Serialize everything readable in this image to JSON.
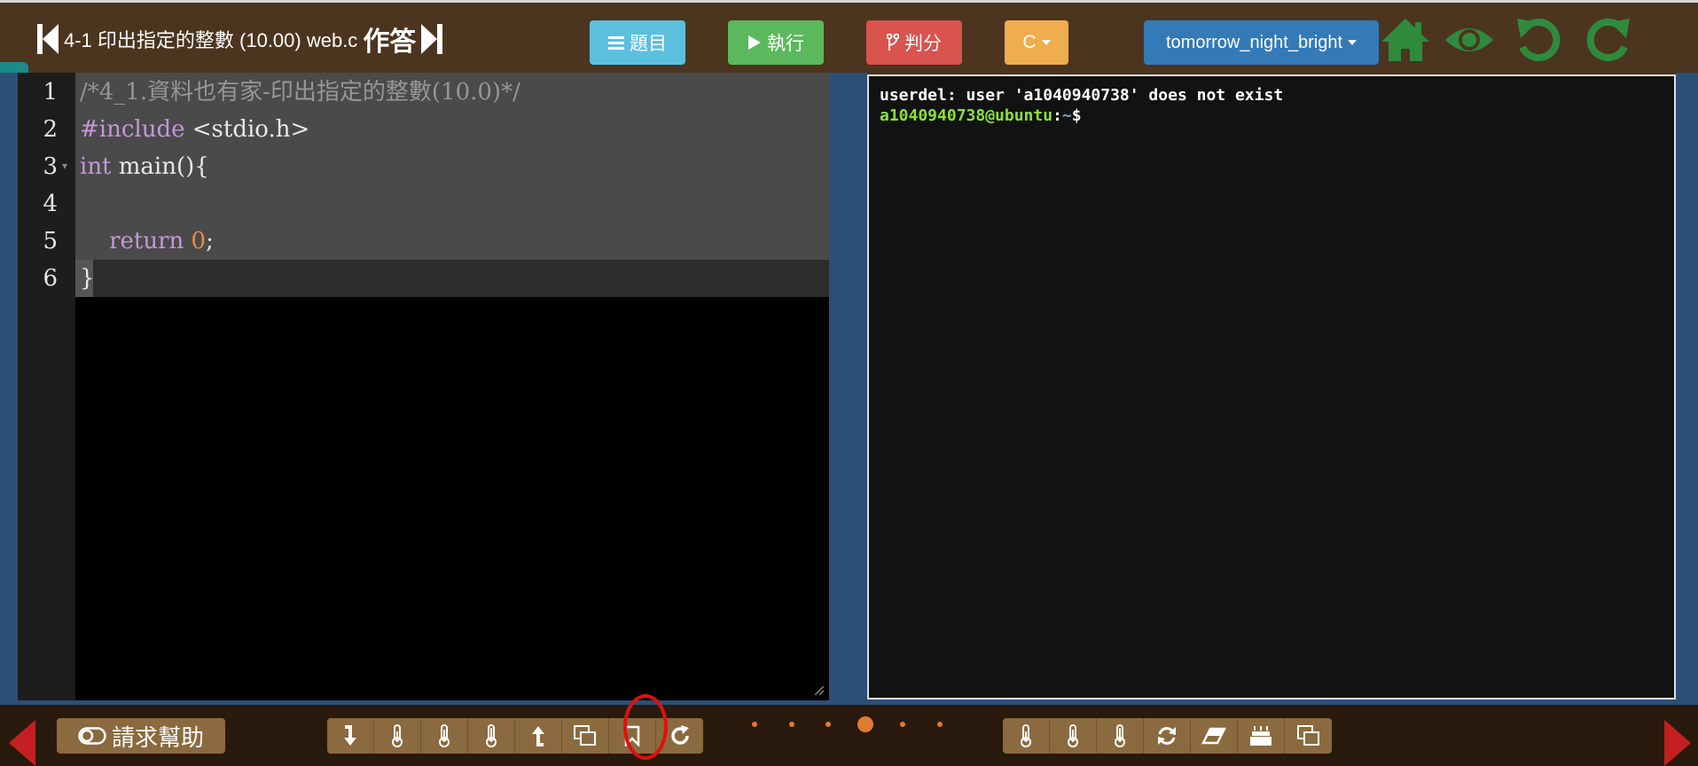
{
  "header": {
    "title": "4-1 印出指定的整數 (10.00) web.c",
    "answer_label": "作答"
  },
  "toolbar": {
    "problem_label": "題目",
    "run_label": "執行",
    "judge_label": "判分",
    "lang_label": "C",
    "theme_label": "tomorrow_night_bright"
  },
  "editor": {
    "line_numbers": [
      "1",
      "2",
      "3",
      "4",
      "5",
      "6"
    ],
    "lines": {
      "l1": "/*4_1.資料也有家-印出指定的整數(10.0)*/",
      "l2_pre": "#include",
      "l2_rest": " <stdio.h>",
      "l3_kw": "int",
      "l3_rest": " main(){",
      "l5_indent": "    ",
      "l5_kw": "return",
      "l5_num": "0",
      "l5_end": ";",
      "l6": "}"
    },
    "spaces": {
      "sp": " "
    }
  },
  "terminal": {
    "line1": "userdel: user 'a1040940738' does not exist",
    "prompt_user": "a1040940738@ubuntu",
    "prompt_sep": ":",
    "prompt_path": "~",
    "prompt_end": "$"
  },
  "bottom": {
    "help_label": "請求幫助"
  },
  "colors": {
    "accent_orange": "#e07a30",
    "annotation_red": "#e01010"
  }
}
